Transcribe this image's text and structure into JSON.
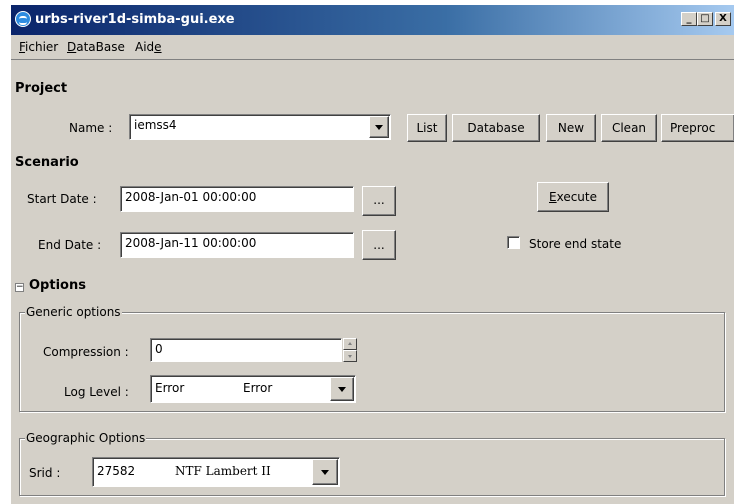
{
  "window": {
    "title": "urbs-river1d-simba-gui.exe"
  },
  "titlebar_buttons": {
    "minimize": "_",
    "maximize": "□",
    "close": "X"
  },
  "menu": [
    {
      "label": "Fichier",
      "underline": "F"
    },
    {
      "label": "DataBase",
      "underline": "D"
    },
    {
      "label": "Aide",
      "underline": "e"
    }
  ],
  "project": {
    "heading": "Project",
    "name_label": "Name :",
    "name_value": "iemss4",
    "buttons": {
      "list": "List",
      "database": "Database",
      "new": "New",
      "clean": "Clean",
      "preproc": "Preproc"
    }
  },
  "scenario": {
    "heading": "Scenario",
    "start_label": "Start Date :",
    "start_value": "2008-Jan-01 00:00:00",
    "end_label": "End Date :",
    "end_value": "2008-Jan-11 00:00:00",
    "browse_label": "...",
    "execute_label": "Execute",
    "store_end_state_label": "Store end state",
    "store_end_state_checked": false
  },
  "options": {
    "heading": "Options",
    "expander": "−",
    "generic": {
      "legend": "Generic options",
      "compression_label": "Compression :",
      "compression_value": "0",
      "log_level_label": "Log Level :",
      "log_level_value": "Error",
      "log_level_display": "Error"
    },
    "geographic": {
      "legend": "Geographic Options",
      "srid_label": "Srid :",
      "srid_code": "27582",
      "srid_name": "NTF Lambert II"
    }
  }
}
